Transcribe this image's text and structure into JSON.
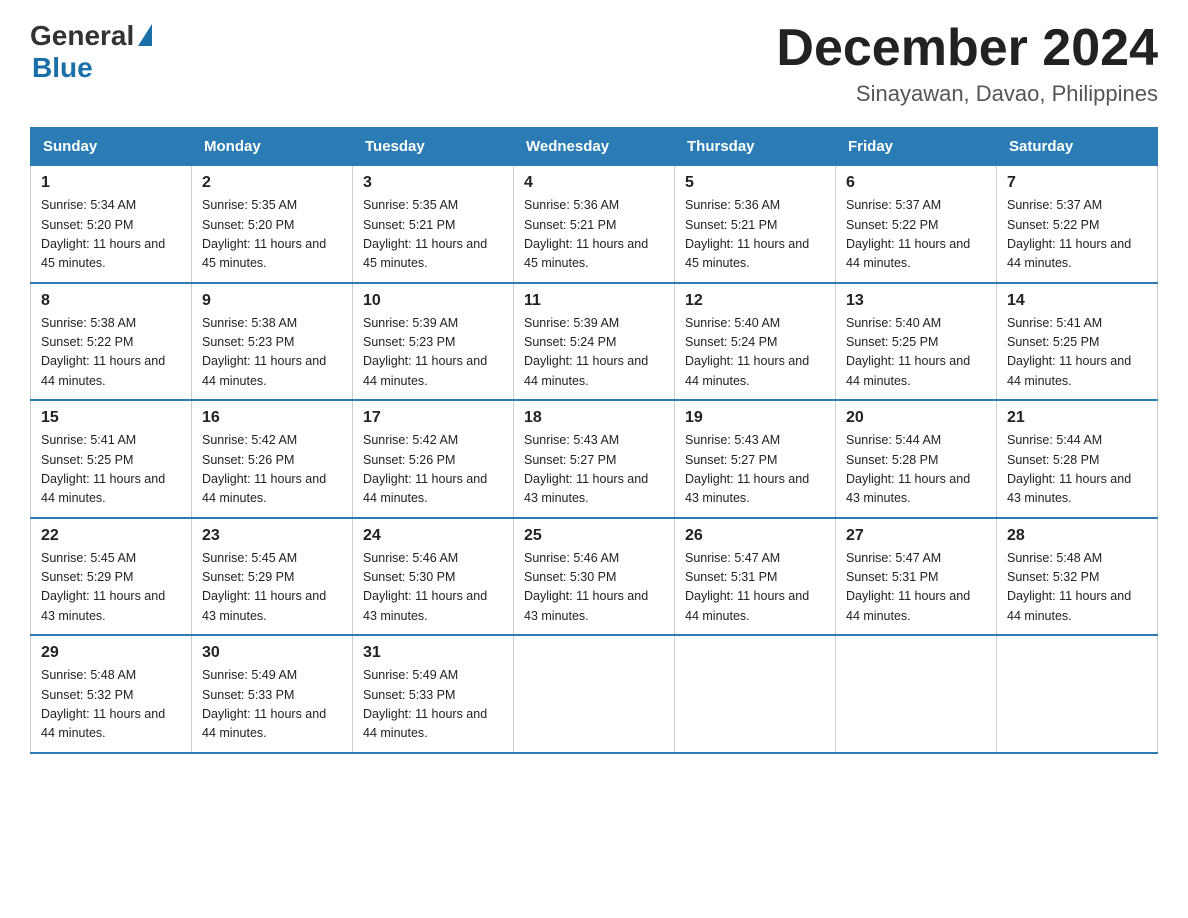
{
  "logo": {
    "general": "General",
    "blue": "Blue"
  },
  "header": {
    "month_title": "December 2024",
    "location": "Sinayawan, Davao, Philippines"
  },
  "weekdays": [
    "Sunday",
    "Monday",
    "Tuesday",
    "Wednesday",
    "Thursday",
    "Friday",
    "Saturday"
  ],
  "weeks": [
    [
      {
        "day": "1",
        "sunrise": "5:34 AM",
        "sunset": "5:20 PM",
        "daylight": "11 hours and 45 minutes."
      },
      {
        "day": "2",
        "sunrise": "5:35 AM",
        "sunset": "5:20 PM",
        "daylight": "11 hours and 45 minutes."
      },
      {
        "day": "3",
        "sunrise": "5:35 AM",
        "sunset": "5:21 PM",
        "daylight": "11 hours and 45 minutes."
      },
      {
        "day": "4",
        "sunrise": "5:36 AM",
        "sunset": "5:21 PM",
        "daylight": "11 hours and 45 minutes."
      },
      {
        "day": "5",
        "sunrise": "5:36 AM",
        "sunset": "5:21 PM",
        "daylight": "11 hours and 45 minutes."
      },
      {
        "day": "6",
        "sunrise": "5:37 AM",
        "sunset": "5:22 PM",
        "daylight": "11 hours and 44 minutes."
      },
      {
        "day": "7",
        "sunrise": "5:37 AM",
        "sunset": "5:22 PM",
        "daylight": "11 hours and 44 minutes."
      }
    ],
    [
      {
        "day": "8",
        "sunrise": "5:38 AM",
        "sunset": "5:22 PM",
        "daylight": "11 hours and 44 minutes."
      },
      {
        "day": "9",
        "sunrise": "5:38 AM",
        "sunset": "5:23 PM",
        "daylight": "11 hours and 44 minutes."
      },
      {
        "day": "10",
        "sunrise": "5:39 AM",
        "sunset": "5:23 PM",
        "daylight": "11 hours and 44 minutes."
      },
      {
        "day": "11",
        "sunrise": "5:39 AM",
        "sunset": "5:24 PM",
        "daylight": "11 hours and 44 minutes."
      },
      {
        "day": "12",
        "sunrise": "5:40 AM",
        "sunset": "5:24 PM",
        "daylight": "11 hours and 44 minutes."
      },
      {
        "day": "13",
        "sunrise": "5:40 AM",
        "sunset": "5:25 PM",
        "daylight": "11 hours and 44 minutes."
      },
      {
        "day": "14",
        "sunrise": "5:41 AM",
        "sunset": "5:25 PM",
        "daylight": "11 hours and 44 minutes."
      }
    ],
    [
      {
        "day": "15",
        "sunrise": "5:41 AM",
        "sunset": "5:25 PM",
        "daylight": "11 hours and 44 minutes."
      },
      {
        "day": "16",
        "sunrise": "5:42 AM",
        "sunset": "5:26 PM",
        "daylight": "11 hours and 44 minutes."
      },
      {
        "day": "17",
        "sunrise": "5:42 AM",
        "sunset": "5:26 PM",
        "daylight": "11 hours and 44 minutes."
      },
      {
        "day": "18",
        "sunrise": "5:43 AM",
        "sunset": "5:27 PM",
        "daylight": "11 hours and 43 minutes."
      },
      {
        "day": "19",
        "sunrise": "5:43 AM",
        "sunset": "5:27 PM",
        "daylight": "11 hours and 43 minutes."
      },
      {
        "day": "20",
        "sunrise": "5:44 AM",
        "sunset": "5:28 PM",
        "daylight": "11 hours and 43 minutes."
      },
      {
        "day": "21",
        "sunrise": "5:44 AM",
        "sunset": "5:28 PM",
        "daylight": "11 hours and 43 minutes."
      }
    ],
    [
      {
        "day": "22",
        "sunrise": "5:45 AM",
        "sunset": "5:29 PM",
        "daylight": "11 hours and 43 minutes."
      },
      {
        "day": "23",
        "sunrise": "5:45 AM",
        "sunset": "5:29 PM",
        "daylight": "11 hours and 43 minutes."
      },
      {
        "day": "24",
        "sunrise": "5:46 AM",
        "sunset": "5:30 PM",
        "daylight": "11 hours and 43 minutes."
      },
      {
        "day": "25",
        "sunrise": "5:46 AM",
        "sunset": "5:30 PM",
        "daylight": "11 hours and 43 minutes."
      },
      {
        "day": "26",
        "sunrise": "5:47 AM",
        "sunset": "5:31 PM",
        "daylight": "11 hours and 44 minutes."
      },
      {
        "day": "27",
        "sunrise": "5:47 AM",
        "sunset": "5:31 PM",
        "daylight": "11 hours and 44 minutes."
      },
      {
        "day": "28",
        "sunrise": "5:48 AM",
        "sunset": "5:32 PM",
        "daylight": "11 hours and 44 minutes."
      }
    ],
    [
      {
        "day": "29",
        "sunrise": "5:48 AM",
        "sunset": "5:32 PM",
        "daylight": "11 hours and 44 minutes."
      },
      {
        "day": "30",
        "sunrise": "5:49 AM",
        "sunset": "5:33 PM",
        "daylight": "11 hours and 44 minutes."
      },
      {
        "day": "31",
        "sunrise": "5:49 AM",
        "sunset": "5:33 PM",
        "daylight": "11 hours and 44 minutes."
      },
      null,
      null,
      null,
      null
    ]
  ]
}
